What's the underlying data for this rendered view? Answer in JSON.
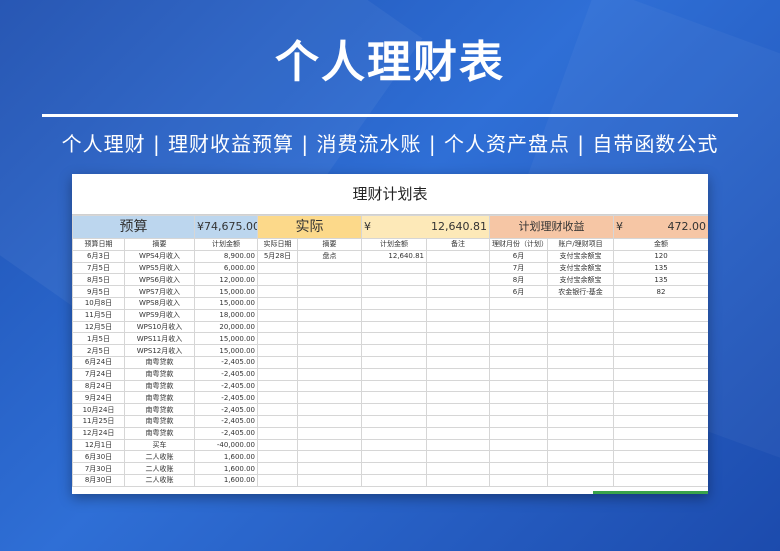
{
  "banner": {
    "title": "个人理财表",
    "subtitle": "个人理财 | 理财收益预算 | 消费流水账 | 个人资产盘点 | 自带函数公式"
  },
  "sheet": {
    "title": "理财计划表",
    "budget": {
      "label": "预算",
      "currency": "¥",
      "total": "74,675.00"
    },
    "actual": {
      "label": "实际",
      "currency": "¥",
      "total": "12,640.81"
    },
    "income": {
      "label": "计划理财收益",
      "currency": "¥",
      "total": "472.00"
    },
    "columns": [
      "预算日期",
      "摘要",
      "计划金额",
      "实际日期",
      "摘要",
      "计划金额",
      "备注",
      "理财月份（计划）",
      "账户/理财项目",
      "金额"
    ],
    "budget_rows": [
      [
        "6月3日",
        "WPS4月收入",
        "8,900.00"
      ],
      [
        "7月5日",
        "WPS5月收入",
        "6,000.00"
      ],
      [
        "8月5日",
        "WPS6月收入",
        "12,000.00"
      ],
      [
        "9月5日",
        "WPS7月收入",
        "15,000.00"
      ],
      [
        "10月8日",
        "WPS8月收入",
        "15,000.00"
      ],
      [
        "11月5日",
        "WPS9月收入",
        "18,000.00"
      ],
      [
        "12月5日",
        "WPS10月收入",
        "20,000.00"
      ],
      [
        "1月5日",
        "WPS11月收入",
        "15,000.00"
      ],
      [
        "2月5日",
        "WPS12月收入",
        "15,000.00"
      ],
      [
        "6月24日",
        "南粤贷款",
        "-2,405.00"
      ],
      [
        "7月24日",
        "南粤贷款",
        "-2,405.00"
      ],
      [
        "8月24日",
        "南粤贷款",
        "-2,405.00"
      ],
      [
        "9月24日",
        "南粤贷款",
        "-2,405.00"
      ],
      [
        "10月24日",
        "南粤贷款",
        "-2,405.00"
      ],
      [
        "11月25日",
        "南粤贷款",
        "-2,405.00"
      ],
      [
        "12月24日",
        "南粤贷款",
        "-2,405.00"
      ],
      [
        "12月1日",
        "买车",
        "-40,000.00"
      ],
      [
        "6月30日",
        "二人收账",
        "1,600.00"
      ],
      [
        "7月30日",
        "二人收账",
        "1,600.00"
      ],
      [
        "8月30日",
        "二人收账",
        "1,600.00"
      ]
    ],
    "actual_rows": [
      [
        "5月28日",
        "盘点",
        "12,640.81",
        ""
      ]
    ],
    "income_rows": [
      [
        "6月",
        "支付宝余额宝",
        "120"
      ],
      [
        "7月",
        "支付宝余额宝",
        "135"
      ],
      [
        "8月",
        "支付宝余额宝",
        "135"
      ],
      [
        "6月",
        "农金银行-基金",
        "82"
      ]
    ]
  }
}
